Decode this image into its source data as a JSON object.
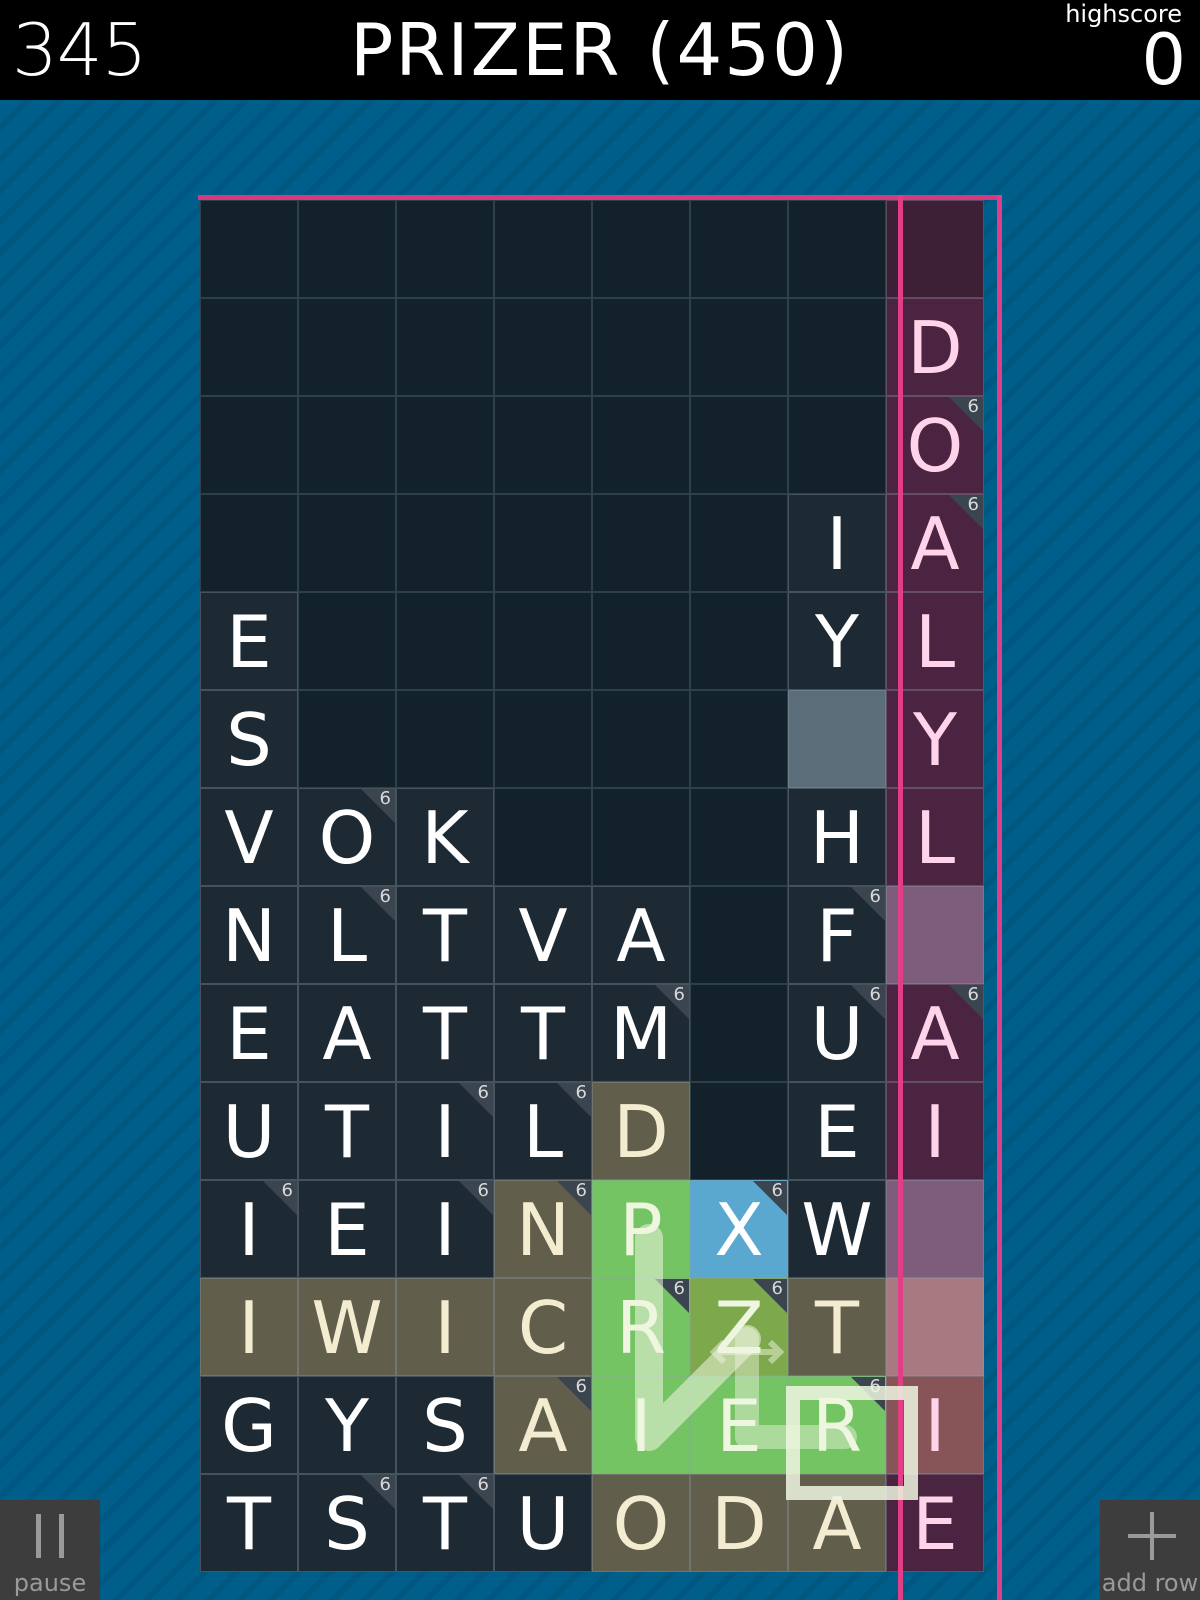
{
  "header": {
    "score": "345",
    "current_word": "PRIZER (450)",
    "highscore_label": "highscore",
    "highscore_value": "0"
  },
  "controls": {
    "pause_label": "pause",
    "add_row_label": "add row"
  },
  "colors": {
    "background": "#005e8a",
    "empty_cell": "#12212a",
    "tile": "#1e2a33",
    "pink_border": "#e23d86",
    "olive_tile": "#615e4c",
    "selected_green": "#75c464",
    "x_tile_blue": "#5aa8d0"
  },
  "grid": {
    "columns": 8,
    "rows": 14,
    "badge_value": "6",
    "cells": [
      [
        {
          "l": "",
          "e": true
        },
        {
          "l": "",
          "e": true
        },
        {
          "l": "",
          "e": true
        },
        {
          "l": "",
          "e": true
        },
        {
          "l": "",
          "e": true
        },
        {
          "l": "",
          "e": true
        },
        {
          "l": "",
          "e": true
        },
        {
          "l": "",
          "bg": "#3e2036"
        }
      ],
      [
        {
          "l": "",
          "e": true
        },
        {
          "l": "",
          "e": true
        },
        {
          "l": "",
          "e": true
        },
        {
          "l": "",
          "e": true
        },
        {
          "l": "",
          "e": true
        },
        {
          "l": "",
          "e": true
        },
        {
          "l": "",
          "e": true
        },
        {
          "l": "D",
          "bg": "#4a2440",
          "c": "#ffd4ea"
        }
      ],
      [
        {
          "l": "",
          "e": true
        },
        {
          "l": "",
          "e": true
        },
        {
          "l": "",
          "e": true
        },
        {
          "l": "",
          "e": true
        },
        {
          "l": "",
          "e": true
        },
        {
          "l": "",
          "e": true
        },
        {
          "l": "",
          "e": true
        },
        {
          "l": "O",
          "bg": "#4a2440",
          "c": "#ffd4ea",
          "b": true
        }
      ],
      [
        {
          "l": "",
          "e": true
        },
        {
          "l": "",
          "e": true
        },
        {
          "l": "",
          "e": true
        },
        {
          "l": "",
          "e": true
        },
        {
          "l": "",
          "e": true
        },
        {
          "l": "",
          "e": true
        },
        {
          "l": "I",
          "bg": "#1e2a33"
        },
        {
          "l": "A",
          "bg": "#4a2440",
          "c": "#ffd4ea",
          "b": true
        }
      ],
      [
        {
          "l": "E",
          "bg": "#1e2a33"
        },
        {
          "l": "",
          "e": true
        },
        {
          "l": "",
          "e": true
        },
        {
          "l": "",
          "e": true
        },
        {
          "l": "",
          "e": true
        },
        {
          "l": "",
          "e": true
        },
        {
          "l": "Y",
          "bg": "#1e2a33"
        },
        {
          "l": "L",
          "bg": "#4a2440",
          "c": "#ffd4ea"
        }
      ],
      [
        {
          "l": "S",
          "bg": "#1e2a33"
        },
        {
          "l": "",
          "e": true
        },
        {
          "l": "",
          "e": true
        },
        {
          "l": "",
          "e": true
        },
        {
          "l": "",
          "e": true
        },
        {
          "l": "",
          "e": true
        },
        {
          "l": "",
          "bg": "#5b6d78"
        },
        {
          "l": "Y",
          "bg": "#4a2440",
          "c": "#ffd4ea"
        }
      ],
      [
        {
          "l": "V",
          "bg": "#1e2a33"
        },
        {
          "l": "O",
          "bg": "#1e2a33",
          "b": true
        },
        {
          "l": "K",
          "bg": "#1e2a33"
        },
        {
          "l": "",
          "e": true
        },
        {
          "l": "",
          "e": true
        },
        {
          "l": "",
          "e": true
        },
        {
          "l": "H",
          "bg": "#1e2a33"
        },
        {
          "l": "L",
          "bg": "#4a2440",
          "c": "#ffd4ea"
        }
      ],
      [
        {
          "l": "N",
          "bg": "#1e2a33"
        },
        {
          "l": "L",
          "bg": "#1e2a33",
          "b": true
        },
        {
          "l": "T",
          "bg": "#1e2a33"
        },
        {
          "l": "V",
          "bg": "#1e2a33"
        },
        {
          "l": "A",
          "bg": "#1e2a33"
        },
        {
          "l": "",
          "e": true
        },
        {
          "l": "F",
          "bg": "#1e2a33",
          "b": true
        },
        {
          "l": "",
          "bg": "#7e5c7c"
        }
      ],
      [
        {
          "l": "E",
          "bg": "#1e2a33"
        },
        {
          "l": "A",
          "bg": "#1e2a33"
        },
        {
          "l": "T",
          "bg": "#1e2a33"
        },
        {
          "l": "T",
          "bg": "#1e2a33"
        },
        {
          "l": "M",
          "bg": "#1e2a33",
          "b": true
        },
        {
          "l": "",
          "e": true
        },
        {
          "l": "U",
          "bg": "#1e2a33",
          "b": true
        },
        {
          "l": "A",
          "bg": "#4a2440",
          "c": "#ffd4ea",
          "b": true
        }
      ],
      [
        {
          "l": "U",
          "bg": "#1e2a33"
        },
        {
          "l": "T",
          "bg": "#1e2a33"
        },
        {
          "l": "I",
          "bg": "#1e2a33",
          "b": true
        },
        {
          "l": "L",
          "bg": "#1e2a33",
          "b": true
        },
        {
          "l": "D",
          "bg": "#615e4c",
          "c": "#f4ecd0"
        },
        {
          "l": "",
          "e": true
        },
        {
          "l": "E",
          "bg": "#1e2a33"
        },
        {
          "l": "I",
          "bg": "#4a2440",
          "c": "#ffd4ea"
        }
      ],
      [
        {
          "l": "I",
          "bg": "#1e2a33",
          "b": true
        },
        {
          "l": "E",
          "bg": "#1e2a33"
        },
        {
          "l": "I",
          "bg": "#1e2a33",
          "b": true
        },
        {
          "l": "N",
          "bg": "#615e4c",
          "c": "#f4ecd0",
          "b": true
        },
        {
          "l": "P",
          "bg": "#75c464",
          "c": "#eef6e0"
        },
        {
          "l": "X",
          "bg": "#5aa8d0",
          "b": true
        },
        {
          "l": "W",
          "bg": "#1e2a33"
        },
        {
          "l": "",
          "bg": "#7e5c7c"
        }
      ],
      [
        {
          "l": "I",
          "bg": "#615e4c",
          "c": "#f4ecd0"
        },
        {
          "l": "W",
          "bg": "#615e4c",
          "c": "#f4ecd0"
        },
        {
          "l": "I",
          "bg": "#615e4c",
          "c": "#f4ecd0"
        },
        {
          "l": "C",
          "bg": "#615e4c",
          "c": "#f4ecd0"
        },
        {
          "l": "R",
          "bg": "#75c464",
          "c": "#eef6e0",
          "b": true
        },
        {
          "l": "Z",
          "bg": "#7ea84c",
          "c": "#eef6e0",
          "b": true
        },
        {
          "l": "T",
          "bg": "#615e4c",
          "c": "#f4ecd0"
        },
        {
          "l": "",
          "bg": "#a67a80"
        }
      ],
      [
        {
          "l": "G",
          "bg": "#1e2a33"
        },
        {
          "l": "Y",
          "bg": "#1e2a33"
        },
        {
          "l": "S",
          "bg": "#1e2a33"
        },
        {
          "l": "A",
          "bg": "#615e4c",
          "c": "#f4ecd0",
          "b": true
        },
        {
          "l": "I",
          "bg": "#75c464",
          "c": "#eef6e0"
        },
        {
          "l": "E",
          "bg": "#75c464",
          "c": "#eef6e0"
        },
        {
          "l": "R",
          "bg": "#75c464",
          "c": "#eef6e0",
          "b": true
        },
        {
          "l": "I",
          "bg": "#875458",
          "c": "#ffd4ea"
        }
      ],
      [
        {
          "l": "T",
          "bg": "#1e2a33"
        },
        {
          "l": "S",
          "bg": "#1e2a33",
          "b": true
        },
        {
          "l": "T",
          "bg": "#1e2a33",
          "b": true
        },
        {
          "l": "U",
          "bg": "#1e2a33"
        },
        {
          "l": "O",
          "bg": "#615e4c",
          "c": "#f4ecd0"
        },
        {
          "l": "D",
          "bg": "#615e4c",
          "c": "#f4ecd0"
        },
        {
          "l": "A",
          "bg": "#615e4c",
          "c": "#f4ecd0"
        },
        {
          "l": "E",
          "bg": "#4a2440",
          "c": "#ffd4ea"
        }
      ]
    ]
  }
}
